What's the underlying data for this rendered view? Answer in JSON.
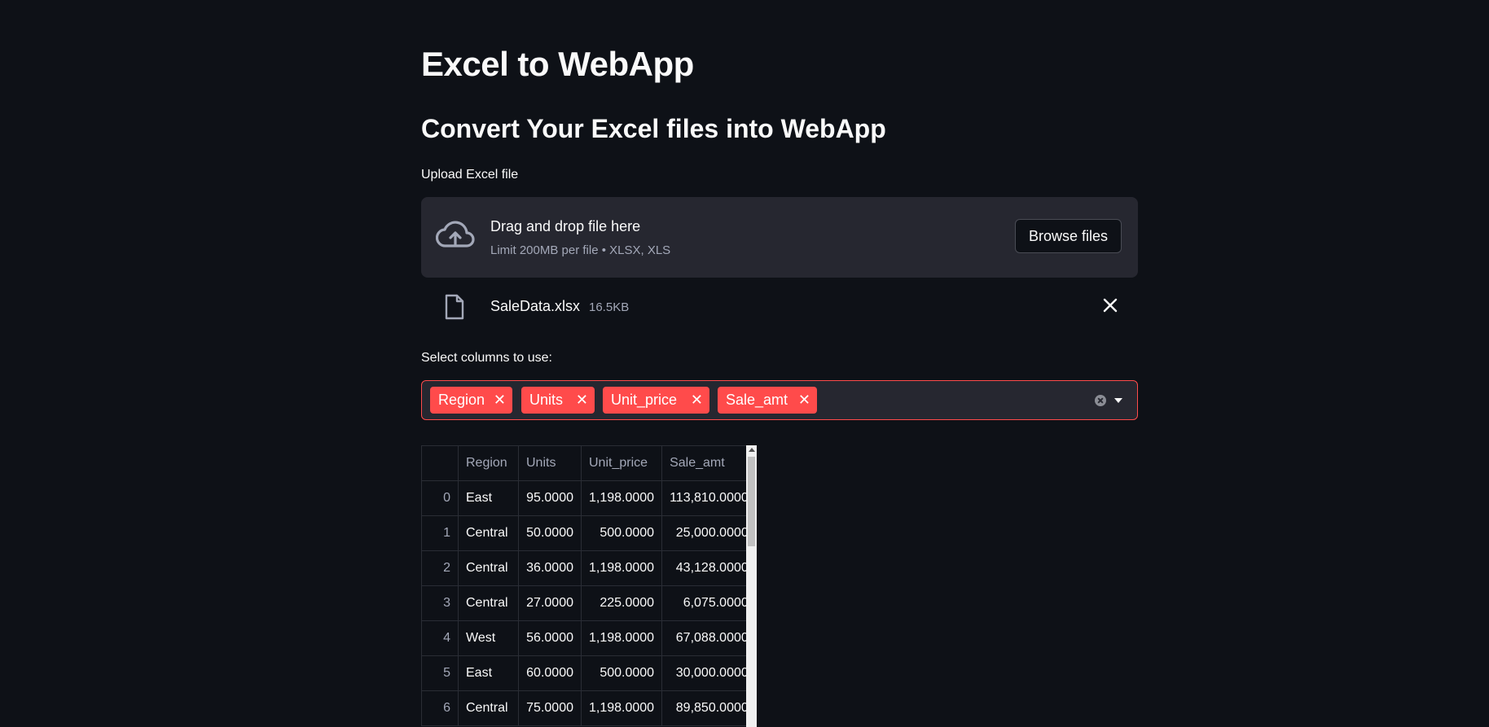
{
  "page": {
    "title": "Excel to WebApp",
    "subtitle": "Convert Your Excel files into WebApp"
  },
  "uploader": {
    "label": "Upload Excel file",
    "drop_text": "Drag and drop file here",
    "hint": "Limit 200MB per file • XLSX, XLS",
    "browse_label": "Browse files",
    "icon": "cloud-upload-icon"
  },
  "uploaded_file": {
    "name": "SaleData.xlsx",
    "size": "16.5KB",
    "icon": "file-icon"
  },
  "columns_select": {
    "label": "Select columns to use:",
    "selected": [
      "Region",
      "Units",
      "Unit_price",
      "Sale_amt"
    ],
    "accent_color": "#ff4b4b"
  },
  "table": {
    "columns": [
      "",
      "Region",
      "Units",
      "Unit_price",
      "Sale_amt"
    ],
    "rows": [
      [
        "0",
        "East",
        "95.0000",
        "1,198.0000",
        "113,810.0000"
      ],
      [
        "1",
        "Central",
        "50.0000",
        "500.0000",
        "25,000.0000"
      ],
      [
        "2",
        "Central",
        "36.0000",
        "1,198.0000",
        "43,128.0000"
      ],
      [
        "3",
        "Central",
        "27.0000",
        "225.0000",
        "6,075.0000"
      ],
      [
        "4",
        "West",
        "56.0000",
        "1,198.0000",
        "67,088.0000"
      ],
      [
        "5",
        "East",
        "60.0000",
        "500.0000",
        "30,000.0000"
      ],
      [
        "6",
        "Central",
        "75.0000",
        "1,198.0000",
        "89,850.0000"
      ]
    ]
  }
}
